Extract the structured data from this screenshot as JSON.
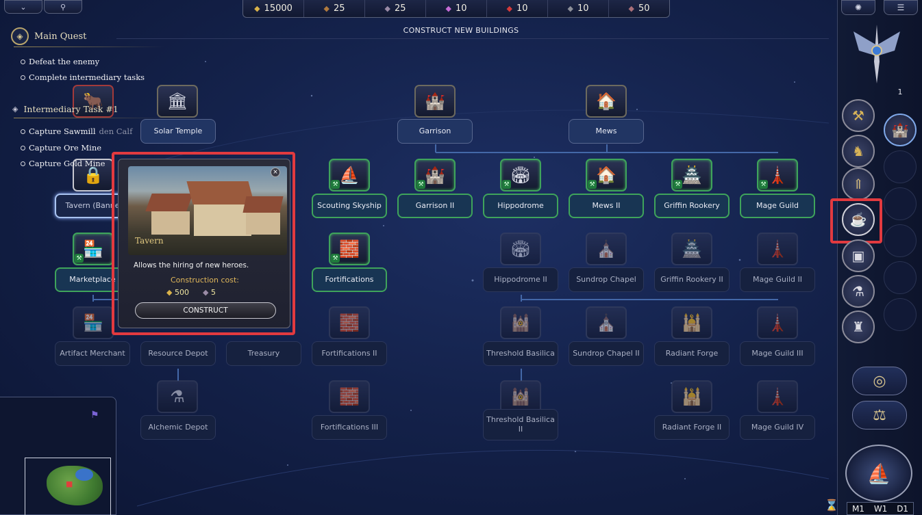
{
  "resources": [
    {
      "icon": "gold-icon",
      "glyph": "◆",
      "color": "#d9b24a",
      "value": "15000"
    },
    {
      "icon": "wood-icon",
      "glyph": "◆",
      "color": "#b07a3e",
      "value": "25"
    },
    {
      "icon": "ore-icon",
      "glyph": "◆",
      "color": "#9a8ba6",
      "value": "25"
    },
    {
      "icon": "crystal-icon",
      "glyph": "◆",
      "color": "#c66cd6",
      "value": "10"
    },
    {
      "icon": "mercury-icon",
      "glyph": "◆",
      "color": "#d43a3a",
      "value": "10"
    },
    {
      "icon": "dust-icon",
      "glyph": "◆",
      "color": "#8c8f99",
      "value": "10"
    },
    {
      "icon": "gems-icon",
      "glyph": "◆",
      "color": "#a96f78",
      "value": "50"
    }
  ],
  "screen_title": "CONSTRUCT NEW BUILDINGS",
  "quest": {
    "main_title": "Main Quest",
    "main_tasks": [
      "Defeat the enemy",
      "Complete intermediary tasks"
    ],
    "intermediary_title": "Intermediary Task #1",
    "intermediary_tasks": [
      "Capture Sawmill",
      "Capture Ore Mine",
      "Capture Gold Mine"
    ]
  },
  "buildings": {
    "solar_temple": "Solar Temple",
    "garrison": "Garrison",
    "mews": "Mews",
    "golden_calf_fragment": "den Calf",
    "tavern_banner": "Tavern (Banne",
    "scouting_skyship": "Scouting Skyship",
    "garrison_ii": "Garrison II",
    "hippodrome": "Hippodrome",
    "mews_ii": "Mews II",
    "griffin_rookery": "Griffin Rookery",
    "mage_guild": "Mage Guild",
    "marketplace": "Marketplace",
    "fortifications": "Fortifications",
    "hippodrome_ii": "Hippodrome II",
    "sundrop_chapel": "Sundrop Chapel",
    "griffin_rookery_ii": "Griffin Rookery II",
    "mage_guild_ii": "Mage Guild II",
    "artifact_merchant": "Artifact Merchant",
    "resource_depot": "Resource Depot",
    "treasury": "Treasury",
    "fortifications_ii": "Fortifications II",
    "threshold_basilica": "Threshold Basilica",
    "sundrop_chapel_ii": "Sundrop Chapel II",
    "radiant_forge": "Radiant Forge",
    "mage_guild_iii": "Mage Guild III",
    "alchemic_depot": "Alchemic Depot",
    "fortifications_iii": "Fortifications III",
    "threshold_basilica_ii": "Threshold Basilica II",
    "radiant_forge_ii": "Radiant Forge II",
    "mage_guild_iv": "Mage Guild IV"
  },
  "tooltip": {
    "title": "Tavern",
    "description": "Allows the hiring of new heroes.",
    "cost_label": "Construction cost:",
    "cost_gold": "500",
    "cost_ore": "5",
    "construct_label": "CONSTRUCT",
    "close_glyph": "×"
  },
  "right_panel": {
    "town_count": "1",
    "calendar": {
      "month": "M1",
      "week": "W1",
      "day": "D1"
    }
  }
}
